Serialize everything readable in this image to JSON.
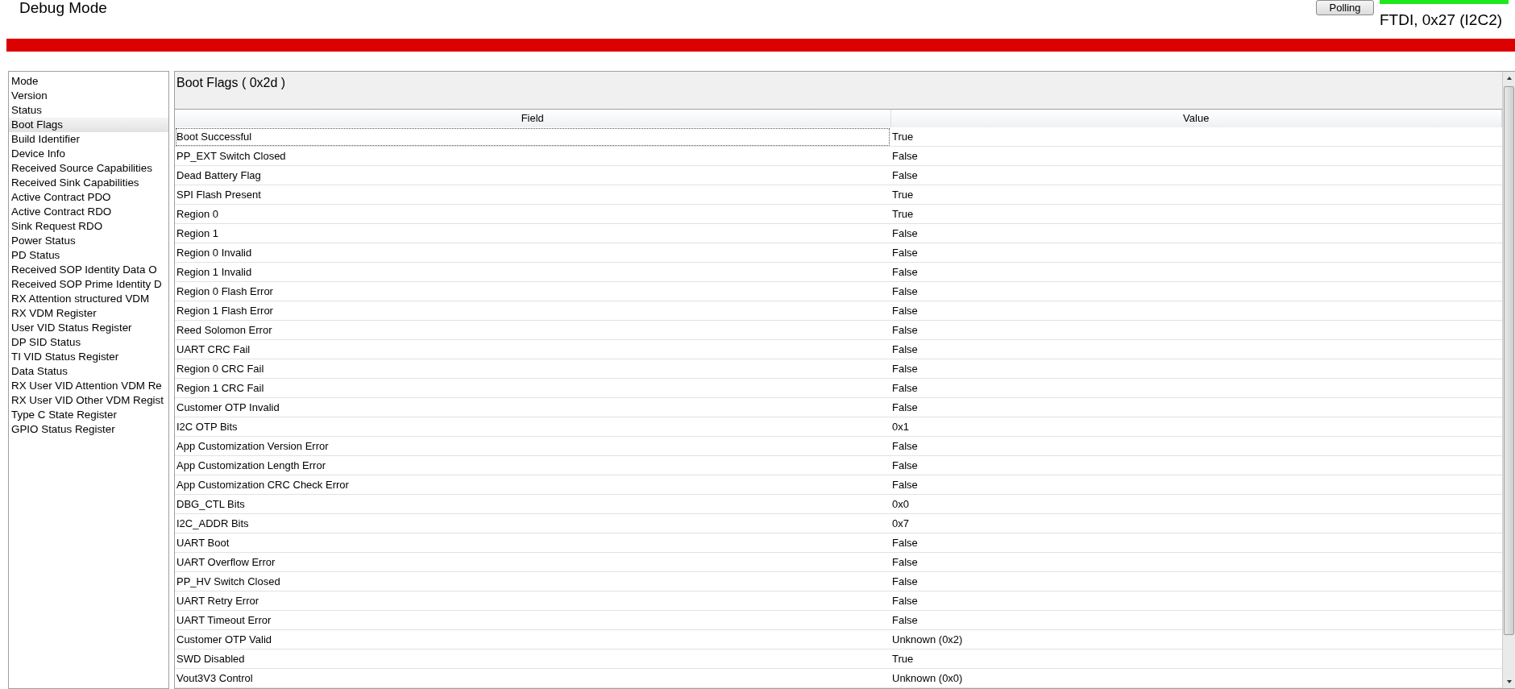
{
  "window": {
    "title": "Debug Mode"
  },
  "toolbar": {
    "polling_button": "Polling",
    "connection": "FTDI, 0x27 (I2C2)"
  },
  "sidebar": {
    "items": [
      {
        "label": "Mode",
        "selected": false
      },
      {
        "label": "Version",
        "selected": false
      },
      {
        "label": "Status",
        "selected": false
      },
      {
        "label": "Boot Flags",
        "selected": true
      },
      {
        "label": "Build Identifier",
        "selected": false
      },
      {
        "label": "Device Info",
        "selected": false
      },
      {
        "label": "Received Source Capabilities",
        "selected": false
      },
      {
        "label": "Received Sink Capabilities",
        "selected": false
      },
      {
        "label": "Active Contract PDO",
        "selected": false
      },
      {
        "label": "Active Contract RDO",
        "selected": false
      },
      {
        "label": "Sink Request RDO",
        "selected": false
      },
      {
        "label": "Power Status",
        "selected": false
      },
      {
        "label": "PD Status",
        "selected": false
      },
      {
        "label": "Received SOP Identity Data O",
        "selected": false
      },
      {
        "label": "Received SOP Prime Identity D",
        "selected": false
      },
      {
        "label": "RX Attention structured VDM",
        "selected": false
      },
      {
        "label": "RX VDM Register",
        "selected": false
      },
      {
        "label": "User VID Status Register",
        "selected": false
      },
      {
        "label": "DP SID Status",
        "selected": false
      },
      {
        "label": "TI VID Status Register",
        "selected": false
      },
      {
        "label": "Data Status",
        "selected": false
      },
      {
        "label": "RX User VID Attention VDM Re",
        "selected": false
      },
      {
        "label": "RX User VID Other VDM Regist",
        "selected": false
      },
      {
        "label": "Type C State Register",
        "selected": false
      },
      {
        "label": "GPIO Status Register",
        "selected": false
      }
    ]
  },
  "panel": {
    "title": "Boot Flags  ( 0x2d )"
  },
  "table": {
    "columns": [
      "Field",
      "Value"
    ],
    "rows": [
      {
        "field": "Boot Successful",
        "value": "True",
        "selected": true
      },
      {
        "field": "PP_EXT Switch Closed",
        "value": "False",
        "selected": false
      },
      {
        "field": "Dead Battery Flag",
        "value": "False",
        "selected": false
      },
      {
        "field": "SPI Flash Present",
        "value": "True",
        "selected": false
      },
      {
        "field": "Region 0",
        "value": "True",
        "selected": false
      },
      {
        "field": "Region 1",
        "value": "False",
        "selected": false
      },
      {
        "field": "Region 0 Invalid",
        "value": "False",
        "selected": false
      },
      {
        "field": "Region 1 Invalid",
        "value": "False",
        "selected": false
      },
      {
        "field": "Region 0 Flash Error",
        "value": "False",
        "selected": false
      },
      {
        "field": "Region 1 Flash Error",
        "value": "False",
        "selected": false
      },
      {
        "field": "Reed Solomon Error",
        "value": "False",
        "selected": false
      },
      {
        "field": "UART CRC Fail",
        "value": "False",
        "selected": false
      },
      {
        "field": "Region 0 CRC Fail",
        "value": "False",
        "selected": false
      },
      {
        "field": "Region 1 CRC Fail",
        "value": "False",
        "selected": false
      },
      {
        "field": "Customer OTP Invalid",
        "value": "False",
        "selected": false
      },
      {
        "field": "I2C OTP Bits",
        "value": "0x1",
        "selected": false
      },
      {
        "field": "App Customization Version Error",
        "value": "False",
        "selected": false
      },
      {
        "field": "App Customization Length Error",
        "value": "False",
        "selected": false
      },
      {
        "field": "App Customization CRC Check Error",
        "value": "False",
        "selected": false
      },
      {
        "field": "DBG_CTL Bits",
        "value": "0x0",
        "selected": false
      },
      {
        "field": "I2C_ADDR Bits",
        "value": "0x7",
        "selected": false
      },
      {
        "field": "UART Boot",
        "value": "False",
        "selected": false
      },
      {
        "field": "UART Overflow Error",
        "value": "False",
        "selected": false
      },
      {
        "field": "PP_HV Switch Closed",
        "value": "False",
        "selected": false
      },
      {
        "field": "UART Retry Error",
        "value": "False",
        "selected": false
      },
      {
        "field": "UART Timeout Error",
        "value": "False",
        "selected": false
      },
      {
        "field": "Customer OTP Valid",
        "value": "Unknown (0x2)",
        "selected": false
      },
      {
        "field": "SWD Disabled",
        "value": "True",
        "selected": false
      },
      {
        "field": "Vout3V3 Control",
        "value": "Unknown (0x0)",
        "selected": false
      }
    ]
  }
}
